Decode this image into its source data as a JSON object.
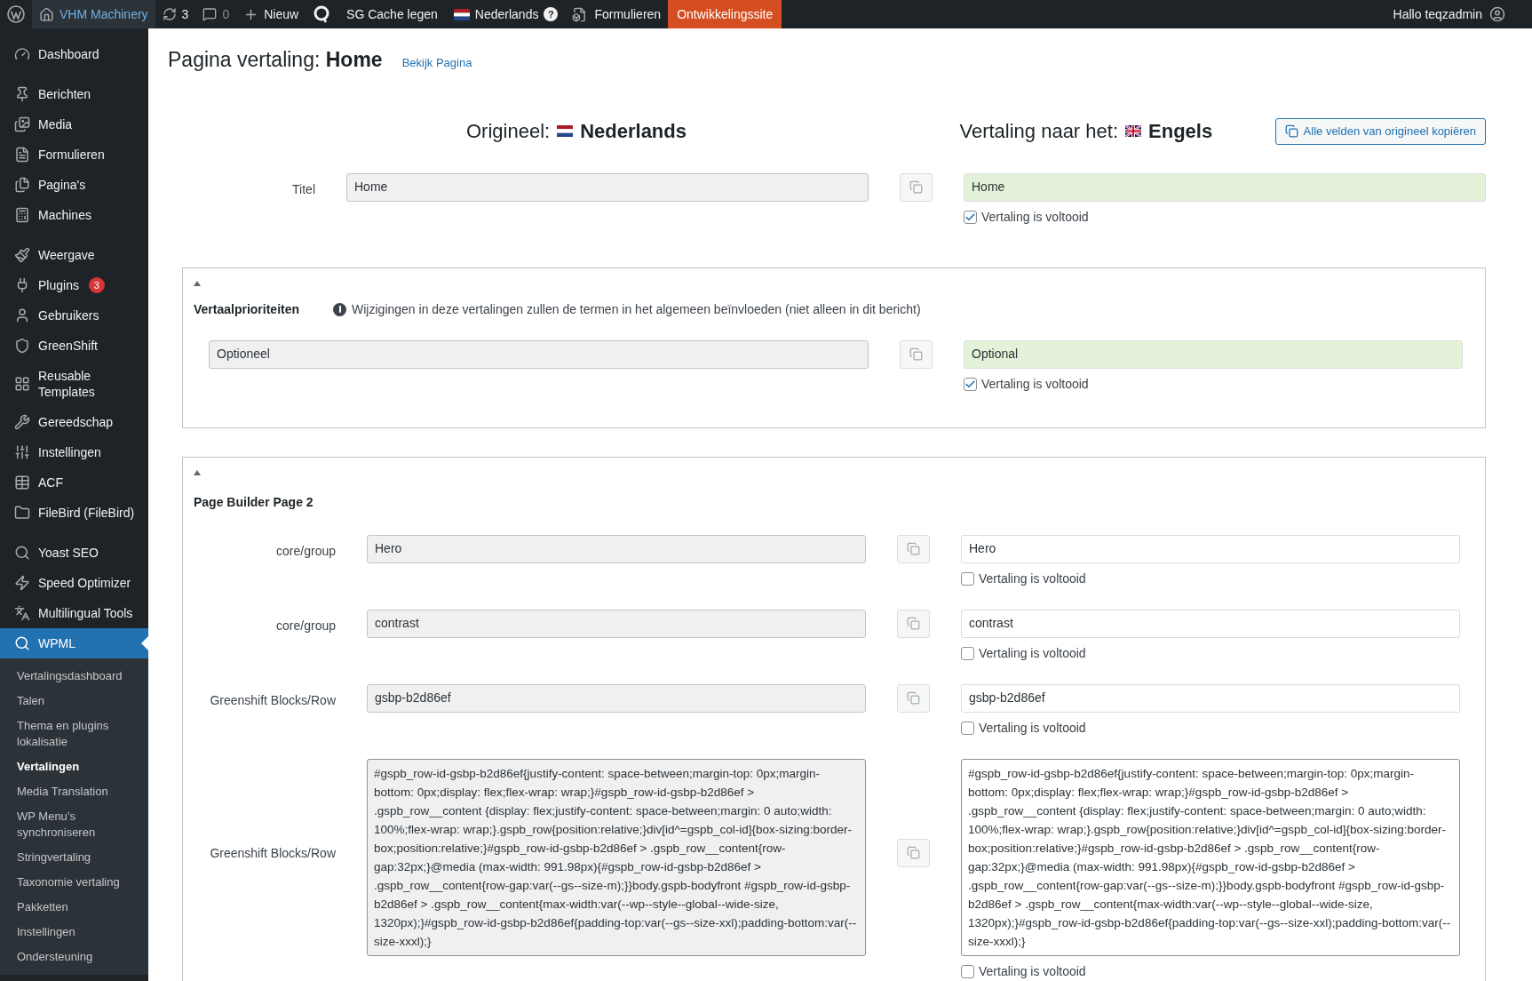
{
  "admin_bar": {
    "items": [
      {
        "kind": "logo"
      },
      {
        "kind": "site",
        "label": "VHM Machinery"
      },
      {
        "kind": "updates",
        "label": "3"
      },
      {
        "kind": "comments",
        "label": "0"
      },
      {
        "kind": "new",
        "label": "Nieuw"
      },
      {
        "kind": "wpml"
      },
      {
        "kind": "text",
        "label": "SG Cache legen"
      },
      {
        "kind": "language",
        "label": "Nederlands",
        "badge": "?"
      },
      {
        "kind": "forms",
        "label": "Formulieren"
      },
      {
        "kind": "environment",
        "label": "Ontwikkelingssite"
      }
    ],
    "greeting": "Hallo teqzadmin"
  },
  "sidebar": {
    "groups": [
      [
        {
          "label": "Dashboard",
          "selected": false
        }
      ],
      [
        {
          "label": "Berichten",
          "selected": false
        },
        {
          "label": "Media",
          "selected": false
        },
        {
          "label": "Formulieren",
          "selected": false
        },
        {
          "label": "Pagina's",
          "selected": false
        },
        {
          "label": "Machines",
          "selected": false
        }
      ],
      [
        {
          "label": "Weergave",
          "selected": false
        },
        {
          "label": "Plugins",
          "badge": "3",
          "selected": false
        },
        {
          "label": "Gebruikers",
          "selected": false
        },
        {
          "label": "GreenShift",
          "selected": false
        },
        {
          "label": "Reusable Templates",
          "selected": false
        },
        {
          "label": "Gereedschap",
          "selected": false
        },
        {
          "label": "Instellingen",
          "selected": false
        },
        {
          "label": "ACF",
          "selected": false
        },
        {
          "label": "FileBird (FileBird)",
          "selected": false
        }
      ],
      [
        {
          "label": "Yoast SEO",
          "selected": false
        },
        {
          "label": "Speed Optimizer",
          "selected": false
        },
        {
          "label": "Multilingual Tools",
          "selected": false
        },
        {
          "label": "WPML",
          "selected": true
        }
      ]
    ],
    "submenu": [
      {
        "label": "Vertalingsdashboard",
        "selected": false
      },
      {
        "label": "Talen",
        "selected": false
      },
      {
        "label": "Thema en plugins lokalisatie",
        "selected": false
      },
      {
        "label": "Vertalingen",
        "selected": true
      },
      {
        "label": "Media Translation",
        "selected": false
      },
      {
        "label": "WP Menu’s synchroniseren",
        "selected": false
      },
      {
        "label": "Stringvertaling",
        "selected": false
      },
      {
        "label": "Taxonomie vertaling",
        "selected": false
      },
      {
        "label": "Pakketten",
        "selected": false
      },
      {
        "label": "Instellingen",
        "selected": false
      },
      {
        "label": "Ondersteuning",
        "selected": false
      }
    ]
  },
  "page": {
    "title_prefix": "Pagina vertaling:",
    "title": "Home",
    "view_link": "Bekijk Pagina"
  },
  "languages": {
    "original_label": "Origineel:",
    "original": "Nederlands",
    "translation_label": "Vertaling naar het:",
    "translation": "Engels",
    "copy_all_button": "Alle velden van origineel kopiëren"
  },
  "title_field": {
    "label": "Titel",
    "original": "Home",
    "translation": "Home",
    "checked": true,
    "status": "Vertaling is voltooid"
  },
  "sections": [
    {
      "title": "Vertaalprioriteiten",
      "expanded": true,
      "notice": "Wijzigingen in deze vertalingen zullen de termen in het algemeen beïnvloeden (niet alleen in dit bericht)",
      "rows": [
        {
          "kind": "text",
          "original": "Optioneel",
          "translation": "Optional",
          "checked": true,
          "status": "Vertaling is voltooid"
        }
      ]
    },
    {
      "title": "Page Builder Page 2",
      "expanded": true,
      "rows": [
        {
          "kind": "text",
          "label": "core/group",
          "original": "Hero",
          "translation": "Hero",
          "checked": false,
          "status": "Vertaling is voltooid"
        },
        {
          "kind": "text",
          "label": "core/group",
          "original": "contrast",
          "translation": "contrast",
          "checked": false,
          "status": "Vertaling is voltooid"
        },
        {
          "kind": "text",
          "label": "Greenshift Blocks/Row",
          "original": "gsbp-b2d86ef",
          "translation": "gsbp-b2d86ef",
          "checked": false,
          "status": "Vertaling is voltooid"
        },
        {
          "kind": "textarea",
          "label": "Greenshift Blocks/Row",
          "original": "#gspb_row-id-gsbp-b2d86ef{justify-content: space-between;margin-top: 0px;margin-bottom: 0px;display: flex;flex-wrap: wrap;}#gspb_row-id-gsbp-b2d86ef > .gspb_row__content {display: flex;justify-content: space-between;margin: 0 auto;width: 100%;flex-wrap: wrap;}.gspb_row{position:relative;}div[id^=gspb_col-id]{box-sizing:border-box;position:relative;}#gspb_row-id-gsbp-b2d86ef > .gspb_row__content{row-gap:32px;}@media (max-width: 991.98px){#gspb_row-id-gsbp-b2d86ef > .gspb_row__content{row-gap:var(--gs--size-m);}}body.gspb-bodyfront #gspb_row-id-gsbp-b2d86ef > .gspb_row__content{max-width:var(--wp--style--global--wide-size, 1320px);}#gspb_row-id-gsbp-b2d86ef{padding-top:var(--gs--size-xxl);padding-bottom:var(--size-xxxl);}",
          "translation": "#gspb_row-id-gsbp-b2d86ef{justify-content: space-between;margin-top: 0px;margin-bottom: 0px;display: flex;flex-wrap: wrap;}#gspb_row-id-gsbp-b2d86ef > .gspb_row__content {display: flex;justify-content: space-between;margin: 0 auto;width: 100%;flex-wrap: wrap;}.gspb_row{position:relative;}div[id^=gspb_col-id]{box-sizing:border-box;position:relative;}#gspb_row-id-gsbp-b2d86ef > .gspb_row__content{row-gap:32px;}@media (max-width: 991.98px){#gspb_row-id-gsbp-b2d86ef > .gspb_row__content{row-gap:var(--gs--size-m);}}body.gspb-bodyfront #gspb_row-id-gsbp-b2d86ef > .gspb_row__content{max-width:var(--wp--style--global--wide-size, 1320px);}#gspb_row-id-gsbp-b2d86ef{padding-top:var(--gs--size-xxl);padding-bottom:var(--size-xxxl);}",
          "checked": false,
          "status": "Vertaling is voltooid"
        }
      ]
    }
  ]
}
